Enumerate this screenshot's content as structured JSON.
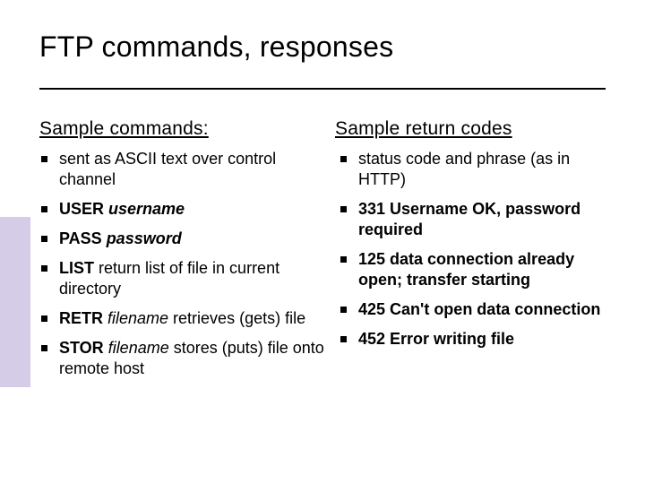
{
  "title": "FTP commands, responses",
  "left": {
    "heading": "Sample commands:",
    "items": {
      "i0": {
        "text": "sent as ASCII text over control channel"
      },
      "i1": {
        "kw": "USER ",
        "arg": "username"
      },
      "i2": {
        "kw": "PASS ",
        "arg": "password"
      },
      "i3": {
        "kw": "LIST",
        "rest": " return list of file in current directory"
      },
      "i4": {
        "kw": "RETR ",
        "arg": "filename",
        "rest": " retrieves (gets) file"
      },
      "i5": {
        "kw": "STOR ",
        "arg": "filename",
        "rest": " stores (puts) file onto remote host"
      }
    }
  },
  "right": {
    "heading": "Sample return codes",
    "items": {
      "r0": {
        "text": "status code and phrase (as in HTTP)"
      },
      "r1": {
        "bold": "331 Username OK, password required"
      },
      "r2": {
        "bold": "125 data connection already open; transfer starting"
      },
      "r3": {
        "bold": "425 Can't open data connection"
      },
      "r4": {
        "bold": "452 Error writing file"
      }
    }
  }
}
